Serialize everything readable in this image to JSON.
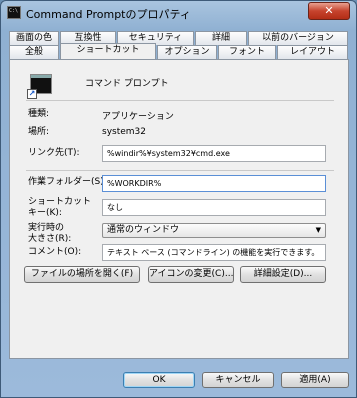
{
  "window": {
    "title": "Command Promptのプロパティ",
    "close_label": "✕"
  },
  "tabs_row1": [
    "画面の色",
    "互換性",
    "セキュリティ",
    "詳細",
    "以前のバージョン"
  ],
  "tabs_row2": [
    "全般",
    "ショートカット",
    "オプション",
    "フォント",
    "レイアウト"
  ],
  "active_tab": "ショートカット",
  "program": {
    "name": "コマンド プロンプト"
  },
  "fields": {
    "type_label": "種類:",
    "type_value": "アプリケーション",
    "location_label": "場所:",
    "location_value": "system32",
    "target_label": "リンク先(T):",
    "target_value": "%windir%¥system32¥cmd.exe",
    "startin_label": "作業フォルダー(S):",
    "startin_value": "%WORKDIR%",
    "shortcut_label": "ショートカット\nキー(K):",
    "shortcut_value": "なし",
    "run_label": "実行時の\n大きさ(R):",
    "run_value": "通常のウィンドウ",
    "comment_label": "コメント(O):",
    "comment_value": "テキスト ベース (コマンドライン) の機能を実行できます。"
  },
  "buttons": {
    "open_location": "ファイルの場所を開く(F)",
    "change_icon": "アイコンの変更(C)...",
    "advanced": "詳細設定(D)...",
    "ok": "OK",
    "cancel": "キャンセル",
    "apply": "適用(A)"
  }
}
